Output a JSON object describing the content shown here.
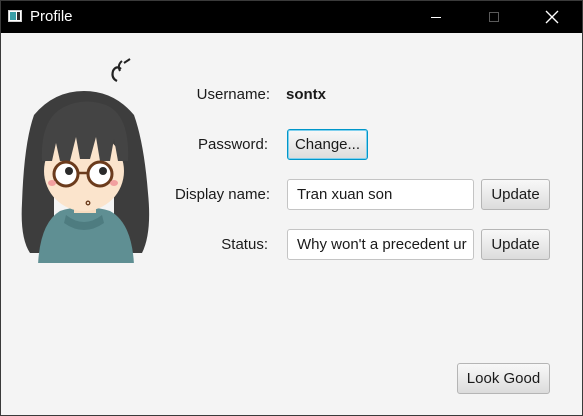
{
  "window": {
    "title": "Profile"
  },
  "profile": {
    "username_label": "Username:",
    "username_value": "sontx",
    "password_label": "Password:",
    "password_button": "Change...",
    "display_name_label": "Display name:",
    "display_name_value": "Tran xuan son",
    "display_name_button": "Update",
    "status_label": "Status:",
    "status_value": "Why won't a precedent ur",
    "status_button": "Update"
  },
  "footer": {
    "confirm_button": "Look Good"
  },
  "icons": {
    "app": "window-app-icon",
    "minimize": "minimize-icon",
    "maximize": "maximize-icon",
    "close": "close-icon",
    "avatar": "cartoon-girl-avatar"
  },
  "colors": {
    "titlebar": "#000000",
    "background": "#f4f4f4",
    "focus_accent": "#0096c9"
  }
}
